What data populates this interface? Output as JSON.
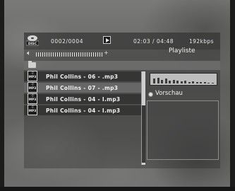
{
  "header": {
    "disc_icon": "disc-icon",
    "disc_label": "DISC",
    "track_counter": "0002/0004",
    "play_icon": "play-icon",
    "time": "02:03 / 04:48",
    "bitrate": "192kbps"
  },
  "playlist_title": "Playliste",
  "volume": {
    "icon": "speaker-icon",
    "plus": "+"
  },
  "files": [
    {
      "icon": "mp3-file-icon",
      "icon_text": "MP3",
      "name": "Phil Collins - 06 - .mp3",
      "selected": false
    },
    {
      "icon": "mp3-file-icon",
      "icon_text": "MP3",
      "name": "Phil Collins - 07 - .mp3",
      "selected": true
    },
    {
      "icon": "mp3-file-icon",
      "icon_text": "MP3",
      "name": "Phil Collins - 04 - I.mp3",
      "selected": false
    },
    {
      "icon": "mp3-file-icon",
      "icon_text": "MP3",
      "name": "Phil Collins - 04 - I.mp3",
      "selected": false
    }
  ],
  "preview": {
    "label": "Vorschau",
    "spectrum_levels": [
      0.55,
      0.7,
      0.45,
      0.6,
      0.35,
      0.4,
      0.3,
      0.25,
      0.3,
      0.2,
      0.25,
      0.15,
      0.2,
      0.15,
      0.1,
      0.12
    ]
  },
  "colors": {
    "selected_row": "#737373",
    "text": "#f2f2f2"
  }
}
